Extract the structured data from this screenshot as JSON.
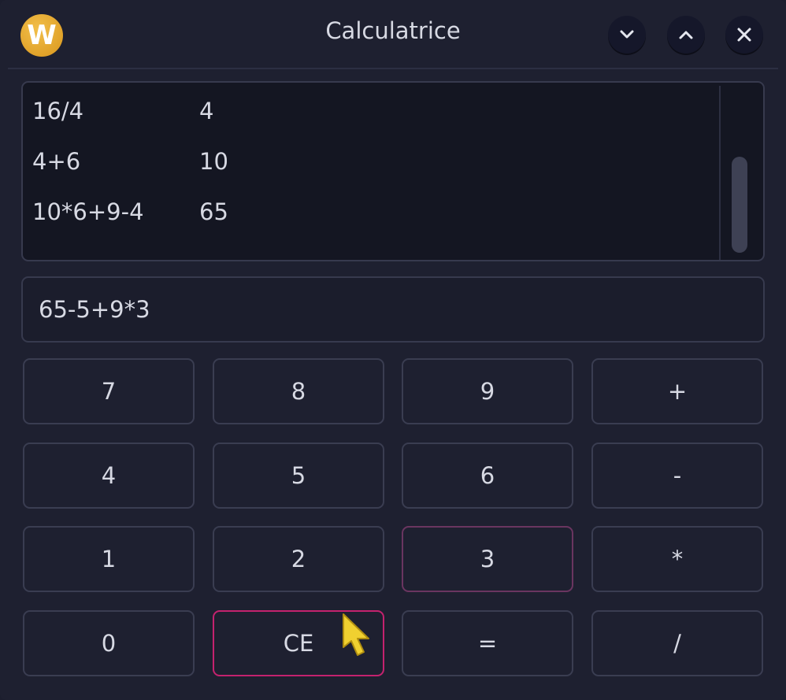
{
  "window": {
    "title": "Calculatrice",
    "logo_letter": "W",
    "controls": {
      "minimize_icon": "chevron-down-icon",
      "maximize_icon": "chevron-up-icon",
      "close_icon": "close-icon"
    }
  },
  "history": [
    {
      "expression": "16/4",
      "result": "4"
    },
    {
      "expression": "4+6",
      "result": "10"
    },
    {
      "expression": "10*6+9-4",
      "result": "65"
    }
  ],
  "input": {
    "value": "65-5+9*3"
  },
  "keypad": [
    [
      "7",
      "8",
      "9",
      "+"
    ],
    [
      "4",
      "5",
      "6",
      "-"
    ],
    [
      "1",
      "2",
      "3",
      "*"
    ],
    [
      "0",
      "CE",
      "=",
      "/"
    ]
  ],
  "colors": {
    "background": "#1e2030",
    "accent_active": "#c4226e",
    "logo": "#e6a92b",
    "cursor": "#f0d030"
  }
}
